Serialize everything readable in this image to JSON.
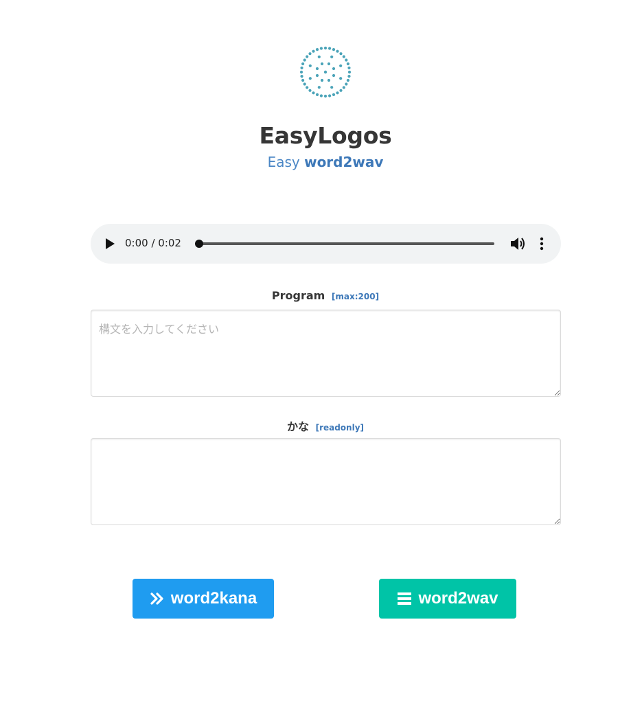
{
  "header": {
    "title": "EasyLogos",
    "subtitle_prefix": "Easy",
    "subtitle_emphasis": "word2wav",
    "logo_icon": "dotted-circle-logo-icon",
    "logo_color": "#4aa3b8"
  },
  "audio_player": {
    "current_time": "0:00",
    "separator": " / ",
    "duration": "0:02",
    "progress": 0,
    "play_icon": "play-icon",
    "volume_icon": "volume-icon",
    "menu_icon": "more-vert-icon"
  },
  "program": {
    "label": "Program",
    "tag": "[max:200]",
    "placeholder": "構文を入力してください",
    "value": ""
  },
  "kana": {
    "label": "かな",
    "tag": "[readonly]",
    "value": ""
  },
  "buttons": {
    "word2kana": {
      "label": "word2kana",
      "icon": "angle-double-right-icon",
      "color": "#1f9cf0"
    },
    "word2wav": {
      "label": "word2wav",
      "icon": "bars-icon",
      "color": "#00c4a7"
    }
  }
}
